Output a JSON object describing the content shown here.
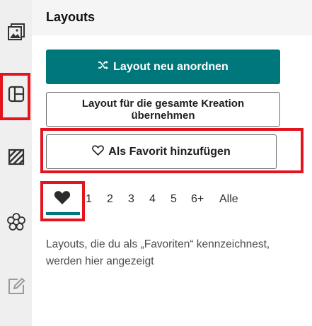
{
  "panel": {
    "title": "Layouts"
  },
  "sidebar": {
    "items": [
      {
        "icon": "image-gallery-icon",
        "active": false
      },
      {
        "icon": "layout-grid-icon",
        "active": true
      },
      {
        "icon": "pattern-icon",
        "active": false
      },
      {
        "icon": "flower-icon",
        "active": false
      },
      {
        "icon": "edit-icon",
        "active": false
      }
    ]
  },
  "buttons": {
    "shuffle_icon": "shuffle-icon",
    "shuffle_label": "Layout neu anordnen",
    "apply_all_label": "Layout für die gesamte Kreation übernehmen",
    "favorite_icon": "heart-outline-icon",
    "favorite_label": "Als Favorit hinzufügen"
  },
  "tabs": {
    "active": "favorites",
    "favorites_icon": "heart-icon",
    "items": [
      "1",
      "2",
      "3",
      "4",
      "5",
      "6+",
      "Alle"
    ]
  },
  "empty_state": {
    "text": "Layouts, die du als „Favoriten“ kennzeichnest, werden hier angezeigt"
  },
  "colors": {
    "accent": "#00777a",
    "highlight": "#e3141d",
    "rail_bg": "#efefef"
  }
}
